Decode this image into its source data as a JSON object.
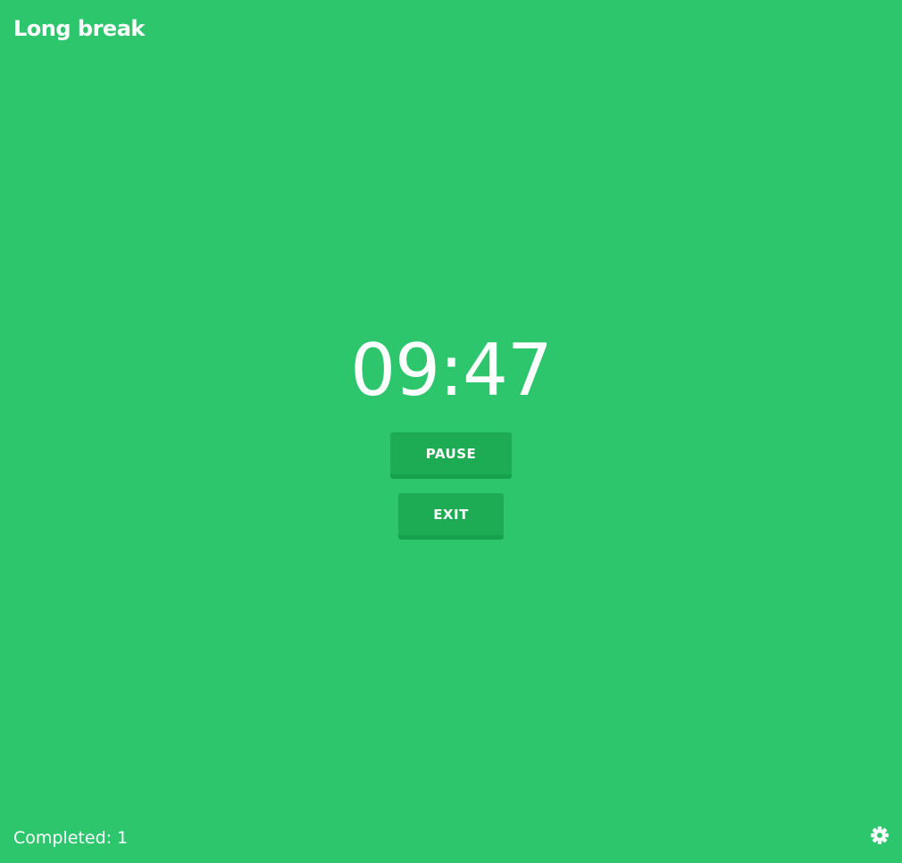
{
  "mode": {
    "title": "Long break"
  },
  "timer": {
    "display": "09:47"
  },
  "controls": {
    "pause_label": "PAUSE",
    "exit_label": "EXIT"
  },
  "footer": {
    "completed_label": "Completed:",
    "completed_count": "1",
    "settings_icon": "gear-icon"
  },
  "colors": {
    "background": "#2dc66c",
    "button": "#1dab54",
    "text": "#ffffff"
  }
}
